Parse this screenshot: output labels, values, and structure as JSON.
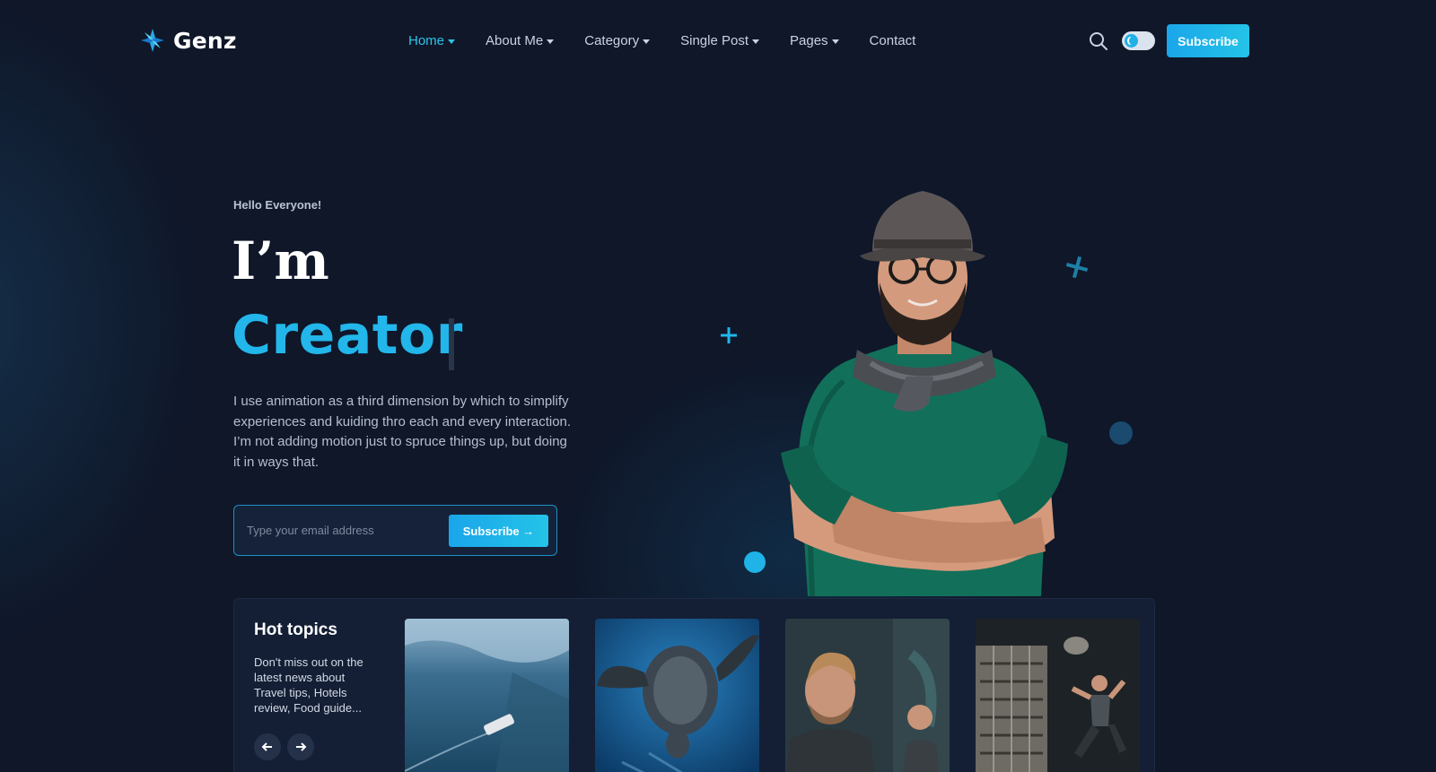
{
  "brand": {
    "name": "Genz",
    "accent": "#22b6ea"
  },
  "nav": {
    "items": [
      {
        "label": "Home",
        "active": true,
        "dropdown": true
      },
      {
        "label": "About Me",
        "active": false,
        "dropdown": true
      },
      {
        "label": "Category",
        "active": false,
        "dropdown": true
      },
      {
        "label": "Single Post",
        "active": false,
        "dropdown": true
      },
      {
        "label": "Pages",
        "active": false,
        "dropdown": true
      },
      {
        "label": "Contact",
        "active": false,
        "dropdown": false
      }
    ]
  },
  "header": {
    "search_icon": "search-icon",
    "theme_toggle_icon": "moon-icon",
    "subscribe_label": "Subscribe"
  },
  "hero": {
    "greeting": "Hello Everyone!",
    "title_line1": "I’m",
    "title_line2": "Creator",
    "description": "I use animation as a third dimension by which to simplify experiences and kuiding thro each and every interaction. I’m not adding motion just to spruce things up, but doing it in ways that.",
    "email_placeholder": "Type your email address",
    "subscribe_label": "Subscribe →"
  },
  "hot_topics": {
    "title": "Hot topics",
    "description": "Don't miss out on the latest news about Travel tips, Hotels review, Food guide...",
    "prev_icon": "arrow-left-icon",
    "next_icon": "arrow-right-icon",
    "cards": [
      {
        "icon": "aerial-boat-photo"
      },
      {
        "icon": "sea-turtle-photo"
      },
      {
        "icon": "gym-man-photo"
      },
      {
        "icon": "gym-workout-photo"
      }
    ]
  }
}
